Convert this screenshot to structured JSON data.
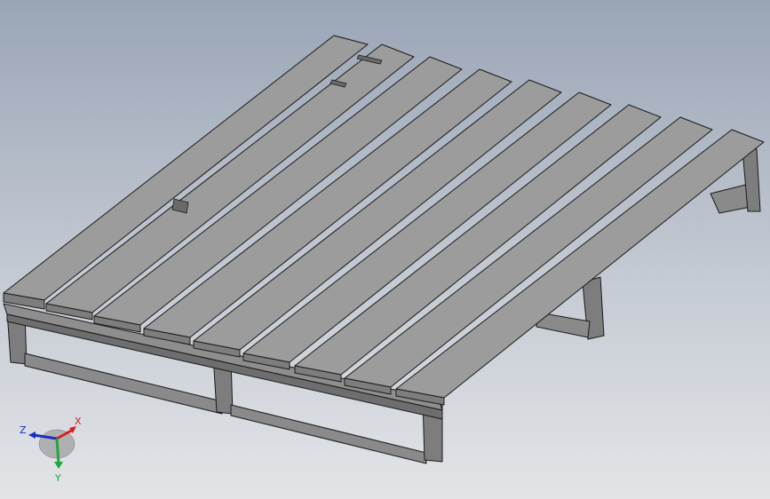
{
  "viewport": {
    "model": "pallet-assembly",
    "background_top": "#9aa5b6",
    "background_bottom": "#e2e4e7"
  },
  "model": {
    "plank_count": 9,
    "plank_top_color": "#9c9c9c",
    "plank_side_color": "#7d7d7d",
    "frame_color": "#8a8a8a",
    "edge_color": "#1a1a1a"
  },
  "triad": {
    "x_label": "X",
    "y_label": "Y",
    "z_label": "Z",
    "x_color": "#d42121",
    "y_color": "#1fa83a",
    "z_color": "#1b2fc4"
  }
}
